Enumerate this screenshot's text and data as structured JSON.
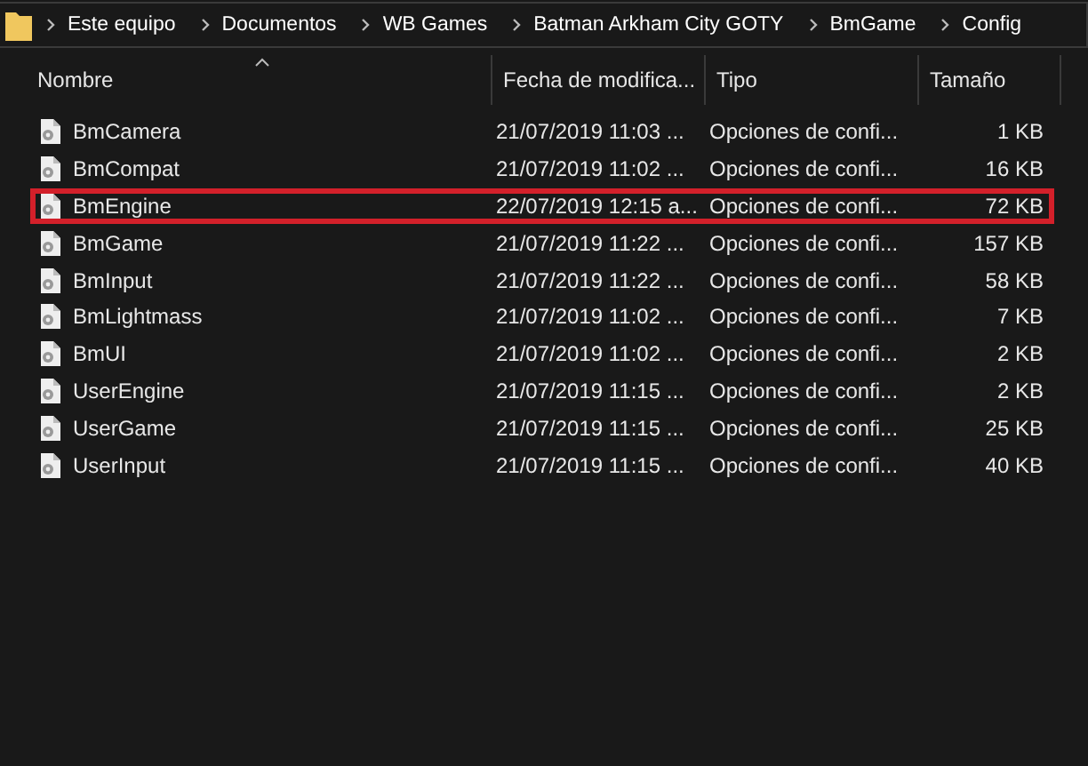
{
  "breadcrumb": [
    "Este equipo",
    "Documentos",
    "WB Games",
    "Batman Arkham City GOTY",
    "BmGame",
    "Config"
  ],
  "columns": [
    {
      "label": "Nombre",
      "sorted": true
    },
    {
      "label": "Fecha de modifica...",
      "sorted": false
    },
    {
      "label": "Tipo",
      "sorted": false
    },
    {
      "label": "Tamaño",
      "sorted": false
    }
  ],
  "rows": [
    {
      "name": "BmCamera",
      "date": "21/07/2019 11:03 ...",
      "type": "Opciones de confi...",
      "size": "1 KB",
      "highlighted": false
    },
    {
      "name": "BmCompat",
      "date": "21/07/2019 11:02 ...",
      "type": "Opciones de confi...",
      "size": "16 KB",
      "highlighted": false
    },
    {
      "name": "BmEngine",
      "date": "22/07/2019 12:15 a...",
      "type": "Opciones de confi...",
      "size": "72 KB",
      "highlighted": true
    },
    {
      "name": "BmGame",
      "date": "21/07/2019 11:22 ...",
      "type": "Opciones de confi...",
      "size": "157 KB",
      "highlighted": false
    },
    {
      "name": "BmInput",
      "date": "21/07/2019 11:22 ...",
      "type": "Opciones de confi...",
      "size": "58 KB",
      "highlighted": false
    },
    {
      "name": "BmLightmass",
      "date": "21/07/2019 11:02 ...",
      "type": "Opciones de confi...",
      "size": "7 KB",
      "highlighted": false
    },
    {
      "name": "BmUI",
      "date": "21/07/2019 11:02 ...",
      "type": "Opciones de confi...",
      "size": "2 KB",
      "highlighted": false
    },
    {
      "name": "UserEngine",
      "date": "21/07/2019 11:15 ...",
      "type": "Opciones de confi...",
      "size": "2 KB",
      "highlighted": false
    },
    {
      "name": "UserGame",
      "date": "21/07/2019 11:15 ...",
      "type": "Opciones de confi...",
      "size": "25 KB",
      "highlighted": false
    },
    {
      "name": "UserInput",
      "date": "21/07/2019 11:15 ...",
      "type": "Opciones de confi...",
      "size": "40 KB",
      "highlighted": false
    }
  ]
}
